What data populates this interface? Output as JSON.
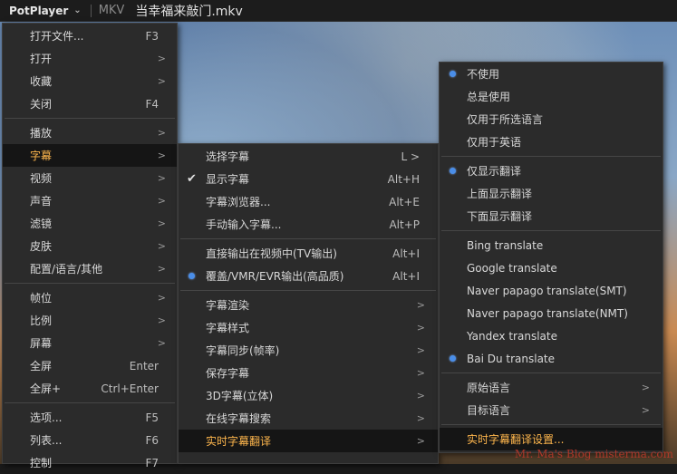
{
  "titlebar": {
    "app": "PotPlayer",
    "format": "MKV",
    "filename": "当幸福来敲门.mkv"
  },
  "main_menu": {
    "items": [
      {
        "label": "打开文件...",
        "shortcut": "F3"
      },
      {
        "label": "打开",
        "arrow": ">"
      },
      {
        "label": "收藏",
        "arrow": ">"
      },
      {
        "label": "关闭",
        "shortcut": "F4"
      },
      {
        "label": "播放",
        "arrow": ">"
      },
      {
        "label": "字幕",
        "arrow": ">"
      },
      {
        "label": "视频",
        "arrow": ">"
      },
      {
        "label": "声音",
        "arrow": ">"
      },
      {
        "label": "滤镜",
        "arrow": ">"
      },
      {
        "label": "皮肤",
        "arrow": ">"
      },
      {
        "label": "配置/语言/其他",
        "arrow": ">"
      },
      {
        "label": "帧位",
        "arrow": ">"
      },
      {
        "label": "比例",
        "arrow": ">"
      },
      {
        "label": "屏幕",
        "arrow": ">"
      },
      {
        "label": "全屏",
        "shortcut": "Enter"
      },
      {
        "label": "全屏+",
        "shortcut": "Ctrl+Enter"
      },
      {
        "label": "选项...",
        "shortcut": "F5"
      },
      {
        "label": "列表...",
        "shortcut": "F6"
      },
      {
        "label": "控制",
        "shortcut": "F7"
      }
    ]
  },
  "subtitle_menu": {
    "items": [
      {
        "label": "选择字幕",
        "shortcut": "L >"
      },
      {
        "label": "显示字幕",
        "shortcut": "Alt+H"
      },
      {
        "label": "字幕浏览器...",
        "shortcut": "Alt+E"
      },
      {
        "label": "手动输入字幕...",
        "shortcut": "Alt+P"
      },
      {
        "label": "直接输出在视频中(TV输出)",
        "shortcut": "Alt+I"
      },
      {
        "label": "覆盖/VMR/EVR输出(高品质)",
        "shortcut": "Alt+I"
      },
      {
        "label": "字幕渲染",
        "arrow": ">"
      },
      {
        "label": "字幕样式",
        "arrow": ">"
      },
      {
        "label": "字幕同步(帧率)",
        "arrow": ">"
      },
      {
        "label": "保存字幕",
        "arrow": ">"
      },
      {
        "label": "3D字幕(立体)",
        "arrow": ">"
      },
      {
        "label": "在线字幕搜索",
        "arrow": ">"
      },
      {
        "label": "实时字幕翻译",
        "arrow": ">"
      }
    ]
  },
  "translate_menu": {
    "items": [
      {
        "label": "不使用"
      },
      {
        "label": "总是使用"
      },
      {
        "label": "仅用于所选语言"
      },
      {
        "label": "仅用于英语"
      },
      {
        "label": "仅显示翻译"
      },
      {
        "label": "上面显示翻译"
      },
      {
        "label": "下面显示翻译"
      },
      {
        "label": "Bing translate"
      },
      {
        "label": "Google translate"
      },
      {
        "label": "Naver papago translate(SMT)"
      },
      {
        "label": "Naver papago translate(NMT)"
      },
      {
        "label": "Yandex translate"
      },
      {
        "label": "Bai Du translate"
      },
      {
        "label": "原始语言",
        "arrow": ">"
      },
      {
        "label": "目标语言",
        "arrow": ">"
      },
      {
        "label": "实时字幕翻译设置..."
      }
    ]
  },
  "watermark": "Mr. Ma's Blog  misterma.com",
  "colors": {
    "highlight_text": "#ffb74d",
    "radio": "#4a8ee8",
    "menu_bg": "#2b2b2b"
  }
}
